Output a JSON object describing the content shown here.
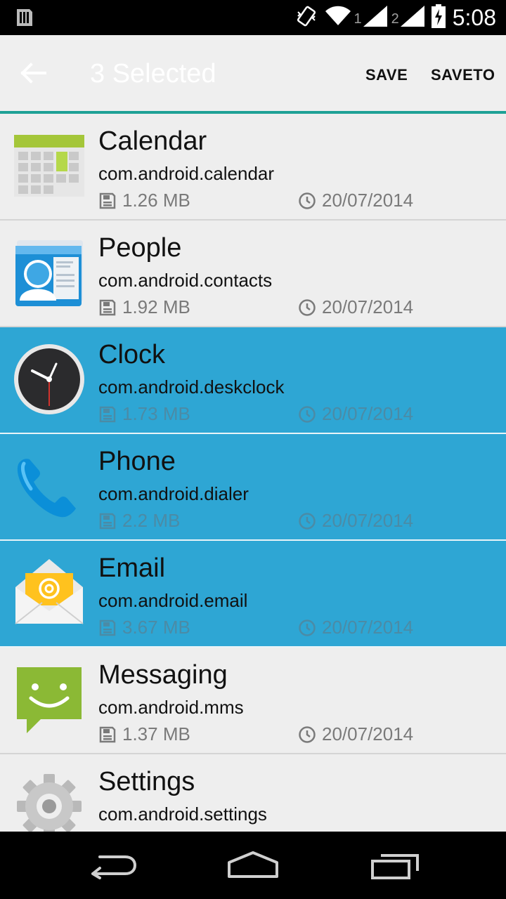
{
  "status_bar": {
    "time": "5:08",
    "sim1": "1",
    "sim2": "2",
    "icons": [
      "sim-card-icon",
      "vibrate-icon",
      "wifi-icon",
      "signal-icon",
      "battery-charging-icon"
    ]
  },
  "action_bar": {
    "title": "3 Selected",
    "save_label": "SAVE",
    "saveto_label": "SAVETO",
    "accent": "#1ea196"
  },
  "apps": [
    {
      "name": "Calendar",
      "package": "com.android.calendar",
      "size": "1.26 MB",
      "date": "20/07/2014",
      "selected": false,
      "icon": "calendar-icon"
    },
    {
      "name": "People",
      "package": "com.android.contacts",
      "size": "1.92 MB",
      "date": "20/07/2014",
      "selected": false,
      "icon": "contacts-icon"
    },
    {
      "name": "Clock",
      "package": "com.android.deskclock",
      "size": "1.73 MB",
      "date": "20/07/2014",
      "selected": true,
      "icon": "clock-icon"
    },
    {
      "name": "Phone",
      "package": "com.android.dialer",
      "size": "2.2 MB",
      "date": "20/07/2014",
      "selected": true,
      "icon": "phone-icon"
    },
    {
      "name": "Email",
      "package": "com.android.email",
      "size": "3.67 MB",
      "date": "20/07/2014",
      "selected": true,
      "icon": "email-icon"
    },
    {
      "name": "Messaging",
      "package": "com.android.mms",
      "size": "1.37 MB",
      "date": "20/07/2014",
      "selected": false,
      "icon": "messaging-icon"
    },
    {
      "name": "Settings",
      "package": "com.android.settings",
      "size": "",
      "date": "",
      "selected": false,
      "icon": "settings-icon"
    }
  ],
  "colors": {
    "selected_row": "#2ea6d4",
    "row": "#eeeeee"
  },
  "nav_bar": {
    "icons": [
      "nav-back-icon",
      "nav-home-icon",
      "nav-recents-icon"
    ]
  }
}
